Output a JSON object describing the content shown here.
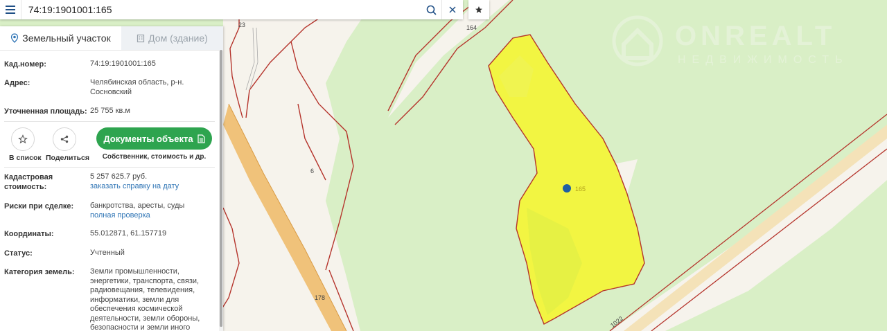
{
  "search": {
    "value": "74:19:1901001:165",
    "placeholder": ""
  },
  "tabs": [
    {
      "label": "Земельный участок",
      "active": true
    },
    {
      "label": "Дом (здание)",
      "active": false
    }
  ],
  "info": {
    "cadastral_number": {
      "label": "Кад.номер:",
      "value": "74:19:1901001:165"
    },
    "address": {
      "label": "Адрес:",
      "value": "Челябинская область, р-н. Сосновский"
    },
    "area": {
      "label": "Уточненная площадь:",
      "value": "25 755 кв.м"
    },
    "cost": {
      "label": "Кадастровая стоимость:",
      "value": "5 257 625.7 руб.",
      "link": "заказать справку на дату"
    },
    "risks": {
      "label": "Риски при сделке:",
      "value": "банкротства, аресты, суды",
      "link": "полная проверка"
    },
    "coords": {
      "label": "Координаты:",
      "value": "55.012871, 61.157719"
    },
    "status": {
      "label": "Статус:",
      "value": "Учтенный"
    },
    "category": {
      "label": "Категория земель:",
      "value": "Земли промышленности, энергетики, транспорта, связи, радиовещания, телевидения, информатики, земли для обеспечения космической деятельности, земли обороны, безопасности и земли иного"
    }
  },
  "actions": {
    "favorite_label": "В список",
    "share_label": "Поделиться",
    "docs_label": "Документы объекта",
    "docs_sub": "Собственник, стоимость и др."
  },
  "map": {
    "labels": {
      "l23": "23",
      "l164": "164",
      "l6": "6",
      "l178": "178",
      "l1022": "1022",
      "parcel": "165"
    },
    "watermark_title": "ONREALT",
    "watermark_sub": "НЕДВИЖИМОСТЬ"
  },
  "colors": {
    "map_bg": "#d9efc6",
    "parcel_fill": "#f2f542",
    "boundary": "#b5342c",
    "road": "#f0c27a",
    "accent": "#2ea44f",
    "link": "#2e74b5",
    "marker": "#1f5fa3"
  }
}
